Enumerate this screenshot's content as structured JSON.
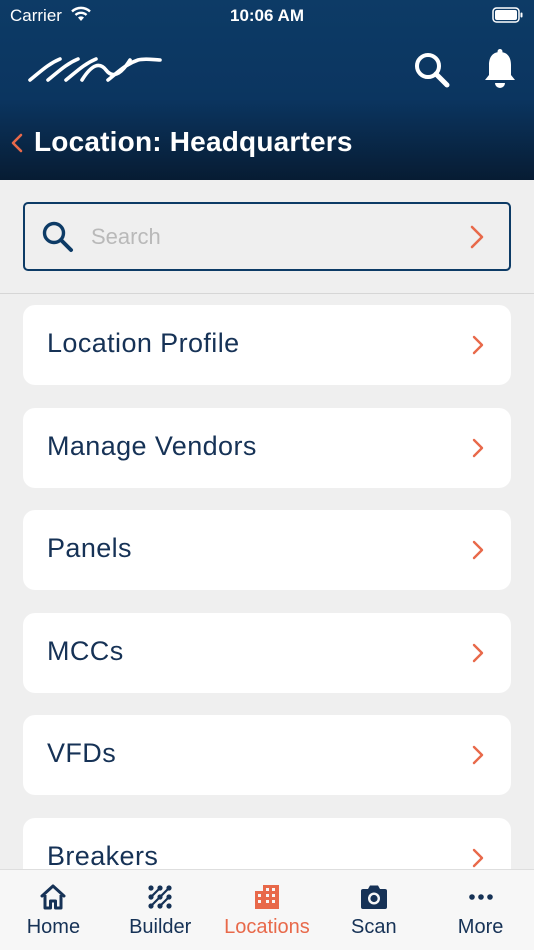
{
  "status_bar": {
    "carrier": "Carrier",
    "time": "10:06 AM"
  },
  "header": {
    "title": "Location: Headquarters"
  },
  "search": {
    "placeholder": "Search",
    "value": ""
  },
  "items": [
    {
      "label": "Location Profile"
    },
    {
      "label": "Manage Vendors"
    },
    {
      "label": "Panels"
    },
    {
      "label": "MCCs"
    },
    {
      "label": "VFDs"
    },
    {
      "label": "Breakers"
    }
  ],
  "tabs": [
    {
      "label": "Home",
      "icon": "home-icon"
    },
    {
      "label": "Builder",
      "icon": "builder-icon"
    },
    {
      "label": "Locations",
      "icon": "building-icon",
      "active": true
    },
    {
      "label": "Scan",
      "icon": "camera-icon"
    },
    {
      "label": "More",
      "icon": "more-icon"
    }
  ],
  "colors": {
    "header": "#0d3b66",
    "accent": "#e8694a",
    "text": "#163256",
    "background": "#efefef"
  }
}
